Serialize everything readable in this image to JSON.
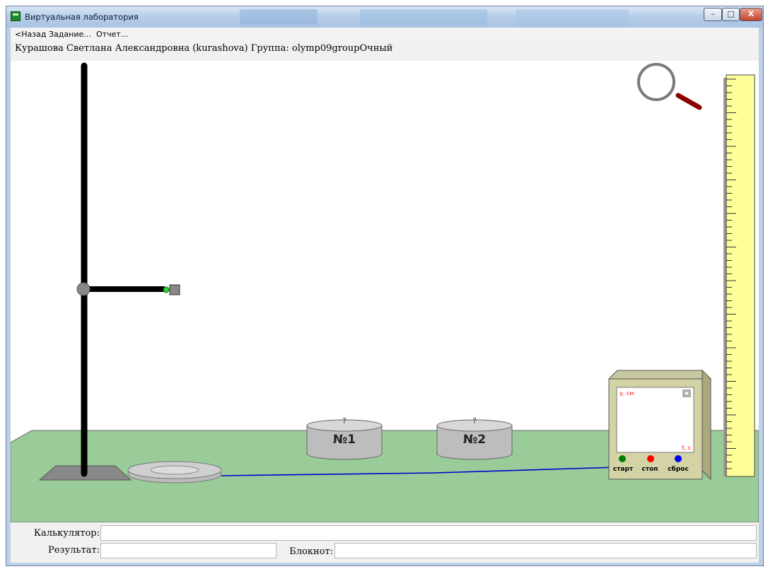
{
  "window": {
    "title": "Виртуальная лаборатория"
  },
  "menu": {
    "back": "<Назад",
    "task": "Задание...",
    "report": "Отчет..."
  },
  "user_line": "Курашова Светлана Александровна (kurashova)  Группа: olymp09groupОчный",
  "lab": {
    "tools": {
      "magnifier_icon": "magnifier-icon"
    },
    "ruler": {
      "color": "#ffff99"
    },
    "tabletop": {
      "color": "#99cc99"
    },
    "cylinders": [
      {
        "label": "№1",
        "mark": "?"
      },
      {
        "label": "№2",
        "mark": "?"
      }
    ],
    "device": {
      "y_label": "y, см",
      "t_label": "t, c",
      "buttons": [
        {
          "label": "старт",
          "color": "#008000"
        },
        {
          "label": "стоп",
          "color": "#ff0000"
        },
        {
          "label": "сброс",
          "color": "#0000ff"
        }
      ]
    },
    "wire_color": "#0000cc"
  },
  "bottom": {
    "calculator_label": "Калькулятор:",
    "calculator_value": "",
    "result_label": "Результат:",
    "result_value": "",
    "notepad_label": "Блокнот:",
    "notepad_value": ""
  }
}
